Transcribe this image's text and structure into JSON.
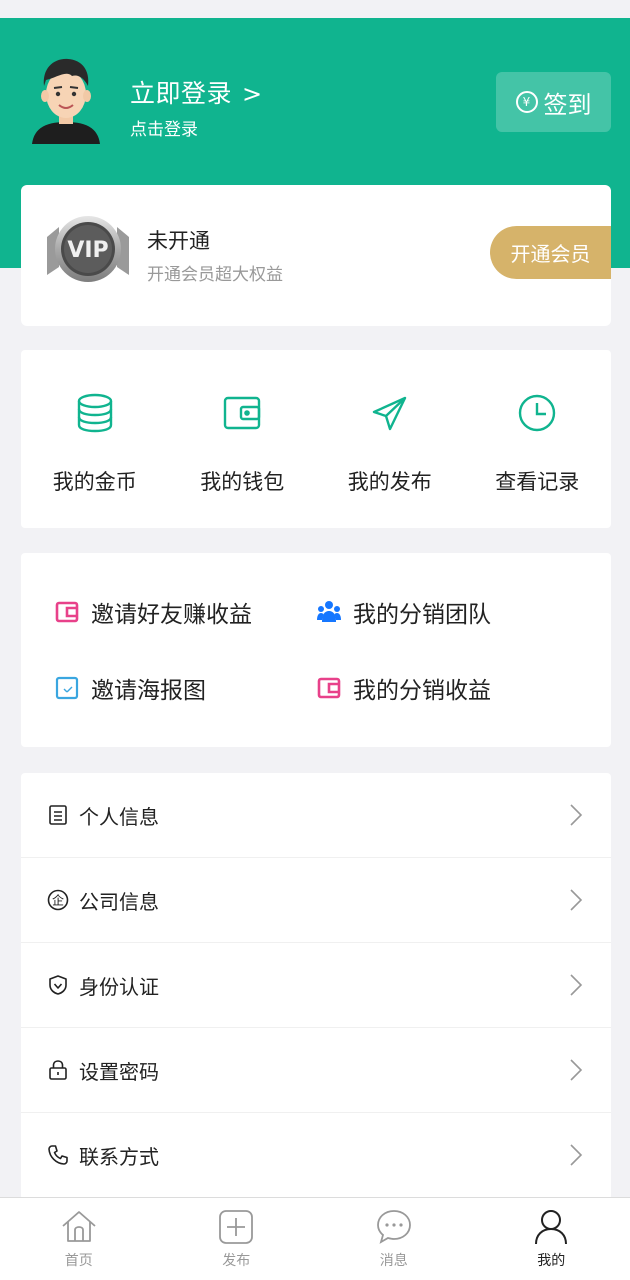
{
  "header": {
    "login_title": "立即登录",
    "login_chevron": ">",
    "login_sub": "点击登录",
    "checkin_label": "签到",
    "checkin_icon_text": "¥",
    "bg_color": "#10b48f"
  },
  "vip": {
    "badge_text": "VIP",
    "title": "未开通",
    "subtitle": "开通会员超大权益",
    "button": "开通会员",
    "accent": "#d6b36a"
  },
  "shortcuts": [
    {
      "label": "我的金币",
      "icon": "coins-stack-icon"
    },
    {
      "label": "我的钱包",
      "icon": "wallet-icon"
    },
    {
      "label": "我的发布",
      "icon": "paper-plane-icon"
    },
    {
      "label": "查看记录",
      "icon": "clock-icon"
    }
  ],
  "distribution": [
    {
      "label": "邀请好友赚收益",
      "icon": "wallet-icon",
      "color": "#e8418a"
    },
    {
      "label": "我的分销团队",
      "icon": "team-icon",
      "color": "#1677ff"
    },
    {
      "label": "邀请海报图",
      "icon": "poster-icon",
      "color": "#3aa6e0"
    },
    {
      "label": "我的分销收益",
      "icon": "wallet-icon",
      "color": "#e8418a"
    }
  ],
  "menu": [
    {
      "label": "个人信息",
      "icon": "document-icon"
    },
    {
      "label": "公司信息",
      "icon": "company-seal-icon",
      "icon_text": "企"
    },
    {
      "label": "身份认证",
      "icon": "shield-icon"
    },
    {
      "label": "设置密码",
      "icon": "lock-icon"
    },
    {
      "label": "联系方式",
      "icon": "phone-icon"
    }
  ],
  "tabs": [
    {
      "label": "首页",
      "icon": "home-icon"
    },
    {
      "label": "发布",
      "icon": "plus-square-icon"
    },
    {
      "label": "消息",
      "icon": "chat-bubble-icon"
    },
    {
      "label": "我的",
      "icon": "person-icon",
      "active": true
    }
  ]
}
